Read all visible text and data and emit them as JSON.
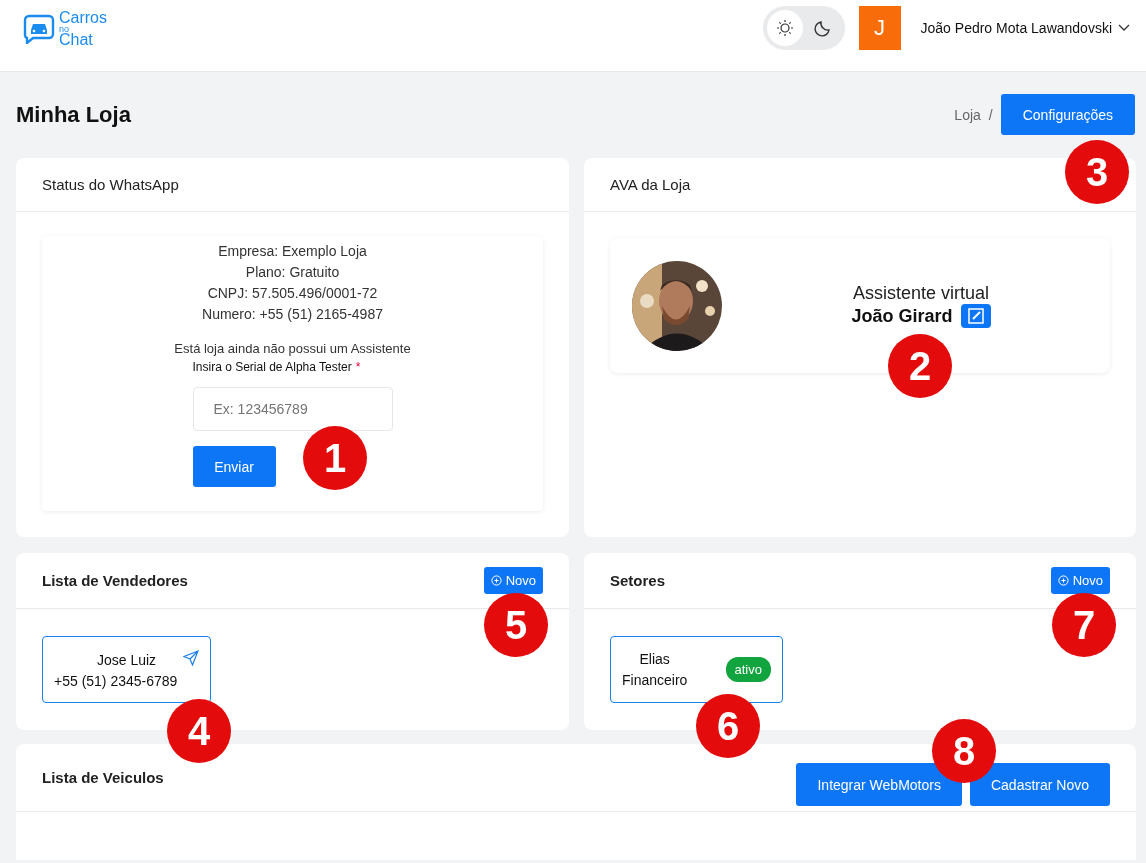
{
  "header": {
    "logo": {
      "line_1": "Carros",
      "line_2": "no",
      "line_3": "Chat"
    },
    "theme_toggle": [
      {
        "kind": "light",
        "selected": true
      },
      {
        "kind": "dark",
        "selected": false
      }
    ],
    "user": {
      "initial": "J",
      "name": "João Pedro Mota Lawandovski"
    }
  },
  "page": {
    "title": "Minha Loja",
    "breadcrumb": "Loja",
    "breadcrumb_separator": "/",
    "settings_button": "Configurações"
  },
  "whatsapp_card": {
    "title": "Status do WhatsApp",
    "info": [
      "Empresa: Exemplo Loja",
      "Plano: Gratuito",
      "CNPJ: 57.505.496/0001-72",
      "Numero: +55 (51) 2165-4987"
    ],
    "notice": "Está loja ainda não possui um Assistente",
    "field_label": "Insira o Serial de Alpha Tester",
    "required_mark": "*",
    "placeholder": "Ex: 123456789",
    "submit_button": "Enviar"
  },
  "ava_card": {
    "title": "AVA da Loja",
    "role": "Assistente virtual",
    "name": "João Girard"
  },
  "sellers_card": {
    "title": "Lista de Vendedores",
    "new_button": "Novo",
    "sellers": [
      {
        "name": "Jose Luiz",
        "phone": "+55 (51) 2345-6789"
      }
    ]
  },
  "sectors_card": {
    "title": "Setores",
    "new_button": "Novo",
    "sectors": [
      {
        "person": "Elias",
        "sector": "Financeiro",
        "status": "ativo",
        "active": true
      }
    ]
  },
  "vehicles_card": {
    "title": "Lista de Veiculos",
    "buttons": [
      "Integrar WebMotors",
      "Cadastrar Novo"
    ]
  },
  "markers": [
    "1",
    "2",
    "3",
    "4",
    "5",
    "6",
    "7",
    "8"
  ]
}
